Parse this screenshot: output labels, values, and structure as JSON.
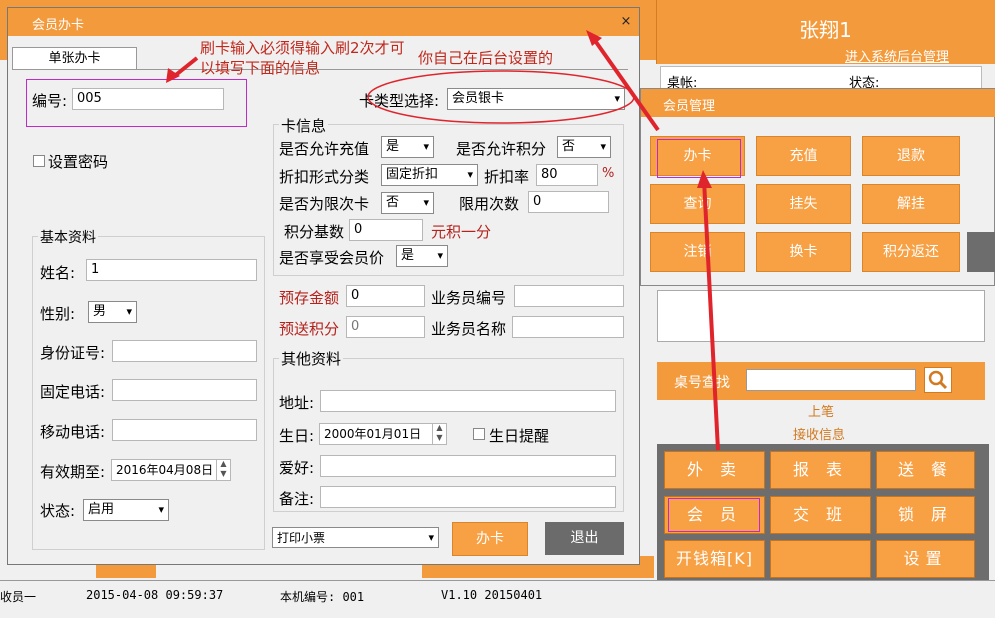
{
  "app": {
    "user_name": "张翔1",
    "admin_link": "进入系统后台管理",
    "table_label": "桌帐:",
    "status_label": "状态:",
    "table_search_label": "桌号查找",
    "link_upper": "上笔",
    "link_receive": "接收信息",
    "func_buttons": [
      "外 卖",
      "报 表",
      "送 餐",
      "会 员",
      "交 班",
      "锁 屏",
      "开钱箱[K]",
      "",
      "设置"
    ],
    "status": {
      "employee": "收员一",
      "datetime": "2015-04-08 09:59:37",
      "machine_label": "本机编号: 001",
      "version": "V1.10  20150401"
    }
  },
  "mgmt": {
    "title": "会员管理",
    "buttons": [
      "办卡",
      "充值",
      "退款",
      "查询",
      "挂失",
      "解挂",
      "注销",
      "换卡",
      "积分返还"
    ]
  },
  "dialog": {
    "title": "会员办卡",
    "close": "×",
    "tab": "单张办卡",
    "number_label": "编号:",
    "number_value": "005",
    "card_type_label": "卡类型选择:",
    "card_type_value": "会员银卡",
    "set_password_label": "设置密码",
    "card_info_title": "卡信息",
    "allow_recharge_label": "是否允许充值",
    "allow_recharge_value": "是",
    "allow_points_label": "是否允许积分",
    "allow_points_value": "否",
    "discount_type_label": "折扣形式分类",
    "discount_type_value": "固定折扣",
    "discount_rate_label": "折扣率",
    "discount_rate_value": "80",
    "percent": "%",
    "limited_label": "是否为限次卡",
    "limited_value": "否",
    "limit_times_label": "限用次数",
    "limit_times_value": "0",
    "points_base_label": "积分基数",
    "points_base_value": "0",
    "points_unit": "元积一分",
    "member_price_label": "是否享受会员价",
    "member_price_value": "是",
    "prestore_label": "预存金额",
    "prestore_value": "0",
    "staff_no_label": "业务员编号",
    "staff_no_value": "",
    "bonus_points_label": "预送积分",
    "bonus_points_value": "0",
    "staff_name_label": "业务员名称",
    "staff_name_value": "",
    "basic_title": "基本资料",
    "name_label": "姓名:",
    "name_value": "1",
    "gender_label": "性别:",
    "gender_value": "男",
    "id_label": "身份证号:",
    "id_value": "",
    "phone_label": "固定电话:",
    "phone_value": "",
    "mobile_label": "移动电话:",
    "mobile_value": "",
    "expire_label": "有效期至:",
    "expire_value": "2016年04月08日",
    "state_label": "状态:",
    "state_value": "启用",
    "other_title": "其他资料",
    "address_label": "地址:",
    "address_value": "",
    "birthday_label": "生日:",
    "birthday_value": "2000年01月01日",
    "birthday_remind_label": "生日提醒",
    "hobby_label": "爱好:",
    "hobby_value": "",
    "remark_label": "备注:",
    "remark_value": "",
    "print_option": "打印小票",
    "ok_button": "办卡",
    "exit_button": "退出"
  },
  "annotations": {
    "swipe_note": "刷卡输入必须得输入刷2次才可以填写下面的信息",
    "backend_note": "你自己在后台设置的"
  },
  "colors": {
    "accent_orange": "#f29a3c",
    "annotation_red": "#e0242c",
    "highlight_magenta": "#c02ac8"
  }
}
